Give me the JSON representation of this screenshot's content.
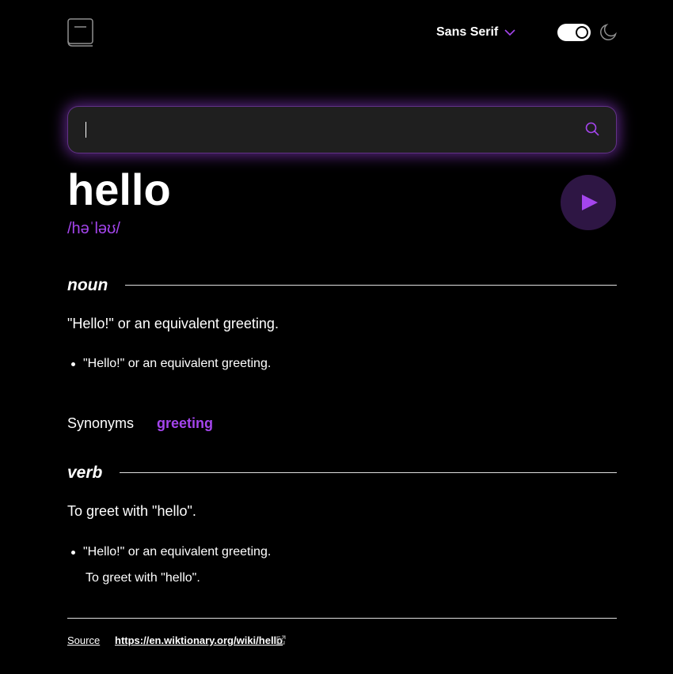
{
  "header": {
    "logo_icon": "book-icon",
    "font_select": {
      "selected": "Sans Serif",
      "chevron_icon": "chevron-down-icon"
    },
    "theme_toggle": {
      "state": "on",
      "icon": "moon-icon"
    }
  },
  "search": {
    "value": "",
    "icon": "search-icon"
  },
  "entry": {
    "word": "hello",
    "phonetic": "/həˈləʊ/",
    "play_icon": "play-icon"
  },
  "meanings": [
    {
      "part_of_speech": "noun",
      "heading": "\"Hello!\" or an equivalent greeting.",
      "definitions": [
        "\"Hello!\" or an equivalent greeting."
      ],
      "synonyms_label": "Synonyms",
      "synonyms": [
        "greeting"
      ]
    },
    {
      "part_of_speech": "verb",
      "heading": "To greet with \"hello\".",
      "definitions": [
        "\"Hello!\" or an equivalent greeting."
      ],
      "example": "To greet with \"hello\"."
    }
  ],
  "footer": {
    "source_label": "Source",
    "source_url": "https://en.wiktionary.org/wiki/hello",
    "external_icon": "external-link-icon"
  },
  "colors": {
    "accent": "#a445ed",
    "background": "#000000",
    "search_bg": "#1f1f1f",
    "play_bg": "#2e1644",
    "text": "#ffffff"
  }
}
